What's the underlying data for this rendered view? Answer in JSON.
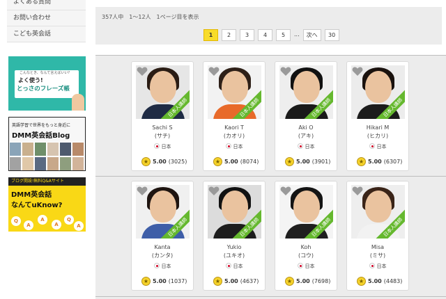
{
  "sidebar": {
    "menu": [
      "よくある質問",
      "お問い合わせ",
      "こども英会話"
    ],
    "banner1": {
      "top": "こんなとき、なんて言えばいい?",
      "mid": "よく使う!",
      "big": "とっさのフレーズ帳"
    },
    "banner2": {
      "top": "英語学習で世界をもっと身近に",
      "logo": "DMM英会話Blog"
    },
    "banner3": {
      "top": "ブログ開設!無料Q&Aサイト",
      "logo": "DMM英会話",
      "sub": "なんてuKnow?",
      "letters": [
        "Q",
        "A",
        "A",
        "A",
        "Q",
        "A"
      ]
    }
  },
  "results": {
    "info": "357人中　1〜12人　1ページ目を表示",
    "pages": [
      "1",
      "2",
      "3",
      "4",
      "5",
      "...",
      "次へ",
      "30"
    ],
    "active_page": "1"
  },
  "tutors": [
    {
      "name": "Sachi S",
      "kana": "(サチ)",
      "country": "日本",
      "rating": "5.00",
      "count": "(3025)",
      "badge": "日本人講師",
      "hair": "#2a1c14",
      "shirt": "#1f2b44",
      "bg": "#e6e6e6"
    },
    {
      "name": "Kaori T",
      "kana": "(カオリ)",
      "country": "日本",
      "rating": "5.00",
      "count": "(8074)",
      "badge": "日本人講師",
      "hair": "#2e2018",
      "shirt": "#e86a2a",
      "bg": "#f2f2f2"
    },
    {
      "name": "Aki O",
      "kana": "(アキ)",
      "country": "日本",
      "rating": "5.00",
      "count": "(3901)",
      "badge": "日本人講師",
      "hair": "#111111",
      "shirt": "#1a1a1a",
      "bg": "#eeeeee"
    },
    {
      "name": "Hikari M",
      "kana": "(ヒカリ)",
      "country": "日本",
      "rating": "5.00",
      "count": "(6307)",
      "badge": "日本人講師",
      "hair": "#1a120e",
      "shirt": "#1c1c1c",
      "bg": "#ececec"
    },
    {
      "name": "Kanta",
      "kana": "(カンタ)",
      "country": "日本",
      "rating": "5.00",
      "count": "(1037)",
      "badge": "日本人講師",
      "hair": "#1e1410",
      "shirt": "#3e5ea8",
      "bg": "#f0f0f0"
    },
    {
      "name": "Yukio",
      "kana": "(ユキオ)",
      "country": "日本",
      "rating": "5.00",
      "count": "(4637)",
      "badge": "日本人講師",
      "hair": "#121212",
      "shirt": "#1d1d1d",
      "bg": "#dcdcdc"
    },
    {
      "name": "Koh",
      "kana": "(コウ)",
      "country": "日本",
      "rating": "5.00",
      "count": "(7698)",
      "badge": "日本人講師",
      "hair": "#141414",
      "shirt": "#1f1f1f",
      "bg": "#f4f4f4"
    },
    {
      "name": "Misa",
      "kana": "(ミサ)",
      "country": "日本",
      "rating": "5.00",
      "count": "(4483)",
      "badge": "日本人講師",
      "hair": "#3a2418",
      "shirt": "#f2f2f2",
      "bg": "#eeeeee"
    }
  ],
  "colors": {
    "active_page": "#f8dc2a",
    "badge": "#65b82e",
    "star": "#f5d22a"
  },
  "icons": {
    "favorite": "heart-icon",
    "rating": "star-icon",
    "country": "japan-flag-icon"
  }
}
